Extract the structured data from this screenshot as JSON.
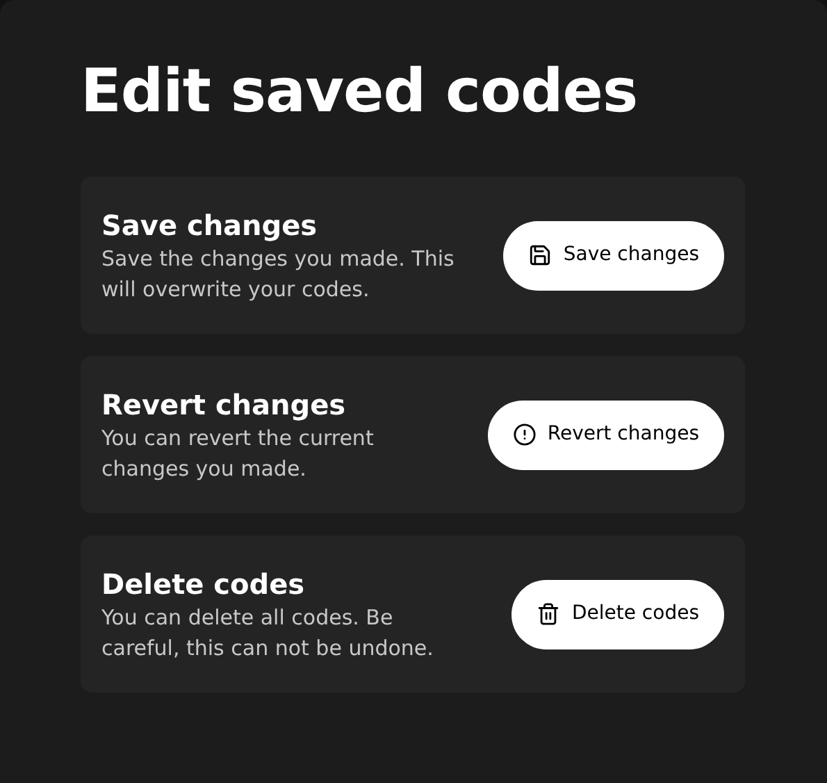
{
  "title": "Edit saved codes",
  "sections": [
    {
      "kind": "save",
      "heading": "Save changes",
      "description": "Save the changes you made. This will overwrite your codes.",
      "button": "Save changes"
    },
    {
      "kind": "revert",
      "heading": "Revert changes",
      "description": "You can revert the current changes you made.",
      "button": "Revert changes"
    },
    {
      "kind": "delete",
      "heading": "Delete codes",
      "description": "You can delete all codes. Be careful, this can not be undone.",
      "button": "Delete codes"
    }
  ]
}
